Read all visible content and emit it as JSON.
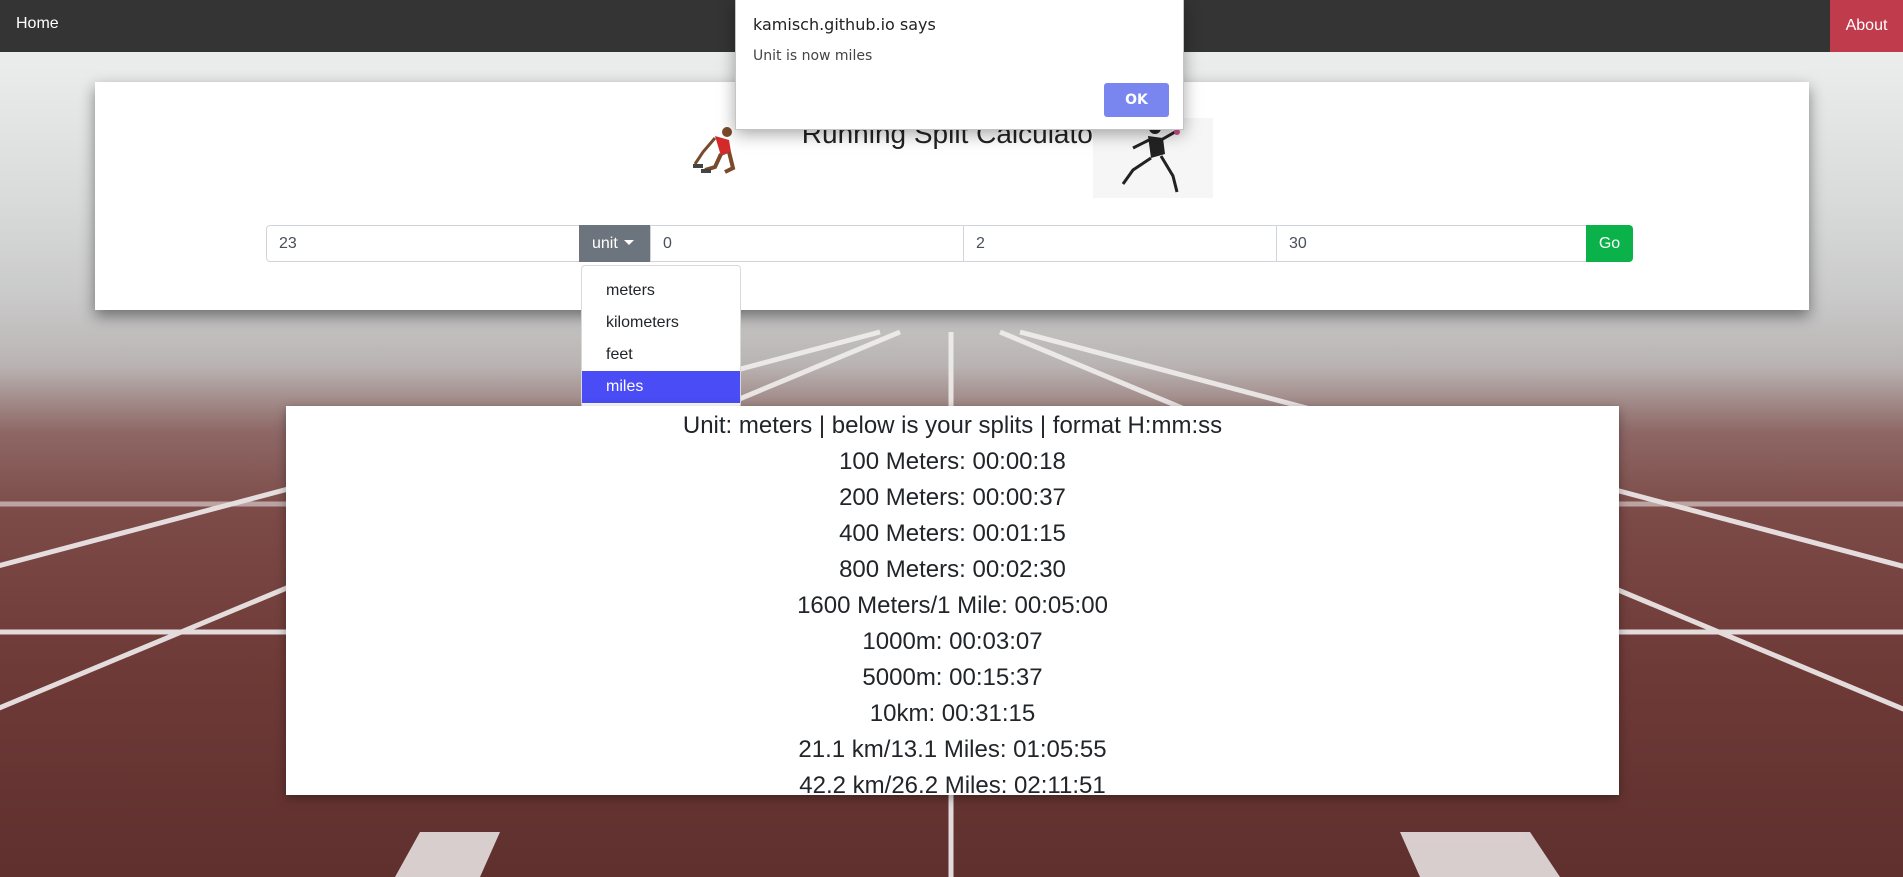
{
  "nav": {
    "home_label": "Home",
    "about_label": "About"
  },
  "header": {
    "title": "Running Split Calculator"
  },
  "form": {
    "distance_value": "23",
    "unit_button_label": "unit",
    "hours_value": "0",
    "minutes_value": "2",
    "seconds_value": "30",
    "go_label": "Go"
  },
  "unit_dropdown": {
    "options": [
      "meters",
      "kilometers",
      "feet",
      "miles"
    ],
    "highlighted": "miles"
  },
  "results": {
    "header": "Unit: meters | below is your splits | format H:mm:ss",
    "splits": [
      "100 Meters: 00:00:18",
      "200 Meters: 00:00:37",
      "400 Meters: 00:01:15",
      "800 Meters: 00:02:30",
      "1600 Meters/1 Mile: 00:05:00",
      "1000m: 00:03:07",
      "5000m: 00:15:37",
      "10km: 00:31:15",
      "21.1 km/13.1 Miles: 01:05:55",
      "42.2 km/26.2 Miles: 02:11:51"
    ]
  },
  "alert": {
    "title": "kamisch.github.io says",
    "message": "Unit is now miles",
    "ok_label": "OK"
  },
  "colors": {
    "navbar": "#343434",
    "about": "#c03b4b",
    "go": "#0bb24a",
    "unit_button": "#6c757d",
    "dropdown_active": "#4a4cf5",
    "alert_ok": "#7a86f0"
  }
}
